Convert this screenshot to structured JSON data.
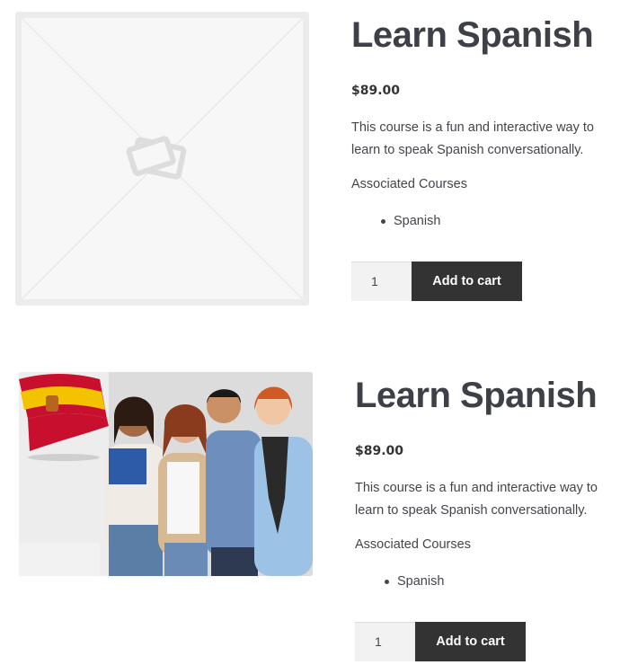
{
  "products": [
    {
      "title": "Learn Spanish",
      "price": "$89.00",
      "description": "This course is a fun and interactive way to learn to speak Spanish conversationally.",
      "associated_label": "Associated Courses",
      "courses": [
        "Spanish"
      ],
      "quantity": "1",
      "add_to_cart_label": "Add to cart",
      "image": "placeholder-image"
    },
    {
      "title": "Learn Spanish",
      "price": "$89.00",
      "description": "This course is a fun and interactive way to learn to speak Spanish conversationally.",
      "associated_label": "Associated Courses",
      "courses": [
        "Spanish"
      ],
      "quantity": "1",
      "add_to_cart_label": "Add to cart",
      "image": "students-with-spanish-flag-photo"
    }
  ],
  "colors": {
    "text": "#43454b",
    "button_bg": "#333333",
    "button_text": "#ffffff",
    "qty_bg": "#f2f2f2",
    "placeholder_bg": "#f7f7f7"
  }
}
